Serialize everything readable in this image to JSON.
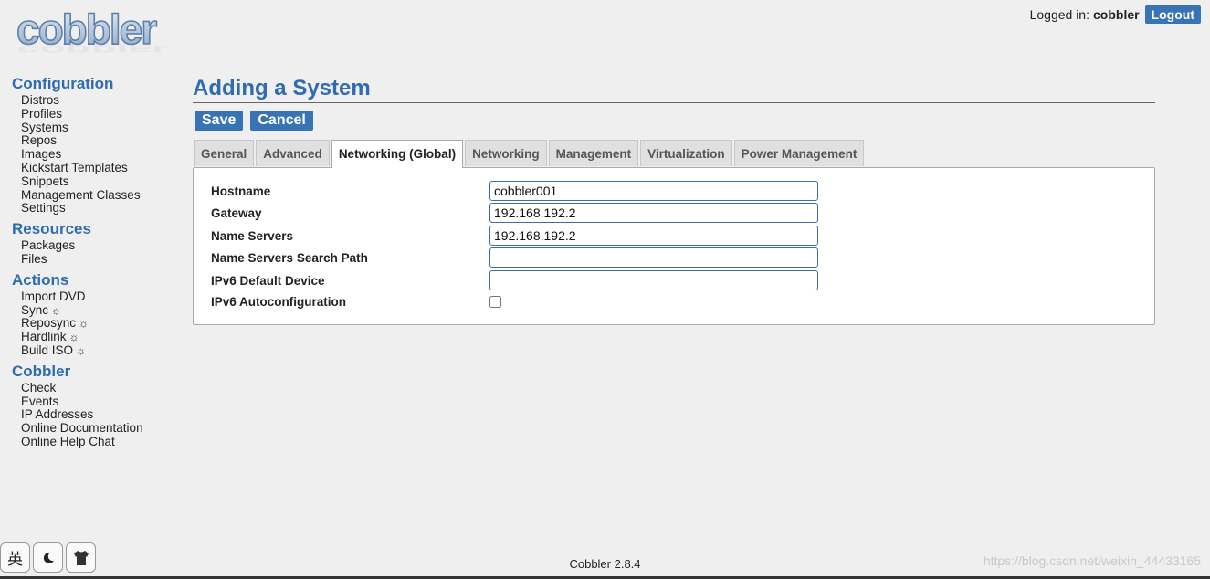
{
  "header": {
    "logo_text": "cobbler",
    "logged_in_label": "Logged in:",
    "username": "cobbler",
    "logout_label": "Logout"
  },
  "sidebar": {
    "sections": [
      {
        "title": "Configuration",
        "items": [
          "Distros",
          "Profiles",
          "Systems",
          "Repos",
          "Images",
          "Kickstart Templates",
          "Snippets",
          "Management Classes",
          "Settings"
        ]
      },
      {
        "title": "Resources",
        "items": [
          "Packages",
          "Files"
        ]
      },
      {
        "title": "Actions",
        "items": [
          "Import DVD",
          "Sync",
          "Reposync",
          "Hardlink",
          "Build ISO"
        ],
        "action_icon": "☼"
      },
      {
        "title": "Cobbler",
        "items": [
          "Check",
          "Events",
          "IP Addresses",
          "Online Documentation",
          "Online Help Chat"
        ]
      }
    ]
  },
  "main": {
    "title": "Adding a System",
    "save_label": "Save",
    "cancel_label": "Cancel",
    "tabs": [
      "General",
      "Advanced",
      "Networking (Global)",
      "Networking",
      "Management",
      "Virtualization",
      "Power Management"
    ],
    "active_tab": "Networking (Global)",
    "fields": [
      {
        "label": "Hostname",
        "value": "cobbler001",
        "type": "text"
      },
      {
        "label": "Gateway",
        "value": "192.168.192.2",
        "type": "text"
      },
      {
        "label": "Name Servers",
        "value": "192.168.192.2",
        "type": "text"
      },
      {
        "label": "Name Servers Search Path",
        "value": "",
        "type": "text"
      },
      {
        "label": "IPv6 Default Device",
        "value": "",
        "type": "text"
      },
      {
        "label": "IPv6 Autoconfiguration",
        "checked": false,
        "type": "checkbox"
      }
    ]
  },
  "footer": {
    "version": "Cobbler 2.8.4",
    "watermark": "https://blog.csdn.net/weixin_44433165"
  },
  "ime_toolbar": {
    "lang_label": "英",
    "icons": [
      "moon-icon",
      "shirt-icon"
    ]
  },
  "colors": {
    "accent": "#3874b5",
    "heading": "#2e6bb0",
    "background": "#efefef"
  }
}
